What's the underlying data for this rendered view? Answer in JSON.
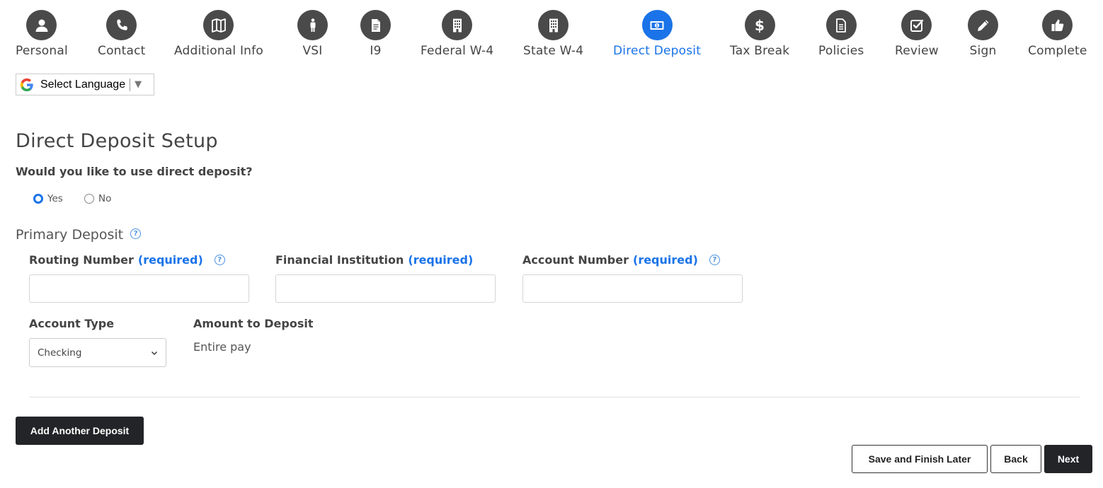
{
  "steps": [
    {
      "label": "Personal",
      "icon": "person-icon"
    },
    {
      "label": "Contact",
      "icon": "phone-icon"
    },
    {
      "label": "Additional Info",
      "icon": "map-icon"
    },
    {
      "label": "VSI",
      "icon": "person-standing-icon"
    },
    {
      "label": "I9",
      "icon": "document-icon"
    },
    {
      "label": "Federal W-4",
      "icon": "building-icon"
    },
    {
      "label": "State W-4",
      "icon": "building-icon"
    },
    {
      "label": "Direct Deposit",
      "icon": "money-icon",
      "active": true
    },
    {
      "label": "Tax Break",
      "icon": "dollar-icon"
    },
    {
      "label": "Policies",
      "icon": "document-icon"
    },
    {
      "label": "Review",
      "icon": "checkbox-icon"
    },
    {
      "label": "Sign",
      "icon": "pencil-icon"
    },
    {
      "label": "Complete",
      "icon": "thumbs-up-icon"
    }
  ],
  "colors": {
    "active": "#1a73e8",
    "step_inactive": "#4a4a4a",
    "dark_button": "#222427"
  },
  "translate": {
    "label": "Select Language",
    "caret": "▼"
  },
  "page_title": "Direct Deposit Setup",
  "question": "Would you like to use direct deposit?",
  "radio": {
    "yes": "Yes",
    "no": "No",
    "selected": "Yes"
  },
  "primary_deposit": {
    "title": "Primary Deposit",
    "help": "?"
  },
  "fields": {
    "routing": {
      "label": "Routing Number",
      "required": "(required)",
      "value": ""
    },
    "institution": {
      "label": "Financial Institution",
      "required": "(required)",
      "value": ""
    },
    "account": {
      "label": "Account Number",
      "required": "(required)",
      "value": ""
    }
  },
  "account_type": {
    "label": "Account Type",
    "value": "Checking"
  },
  "amount": {
    "label": "Amount to Deposit",
    "value": "Entire pay"
  },
  "buttons": {
    "add_deposit": "Add Another Deposit",
    "save_later": "Save and Finish Later",
    "back": "Back",
    "next": "Next"
  }
}
